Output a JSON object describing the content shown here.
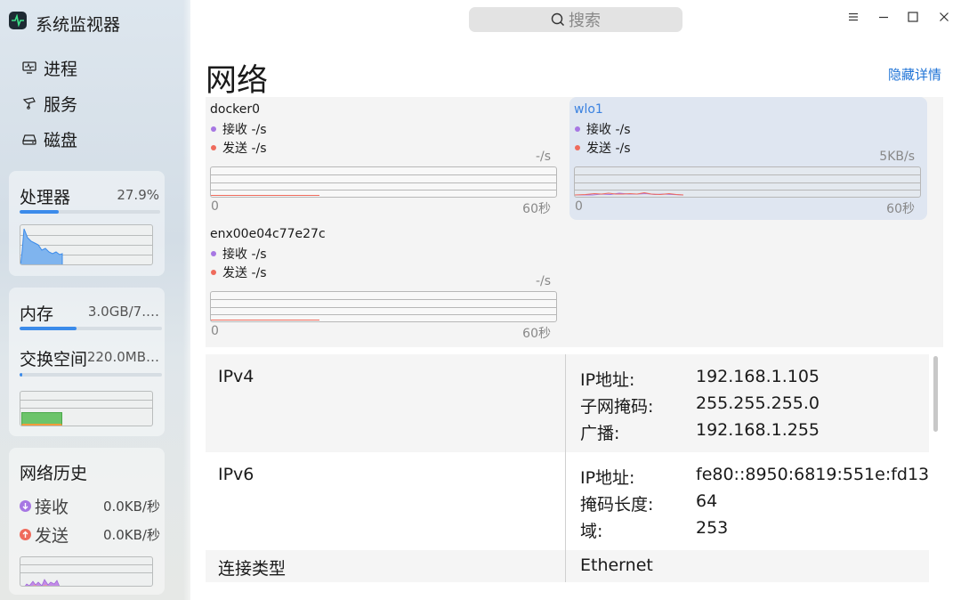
{
  "app": {
    "title": "系统监视器"
  },
  "nav": [
    {
      "label": "进程",
      "icon": "monitor-icon"
    },
    {
      "label": "服务",
      "icon": "service-icon"
    },
    {
      "label": "磁盘",
      "icon": "disk-icon"
    }
  ],
  "cpu": {
    "title": "处理器",
    "value": "27.9%",
    "percent": 0.279
  },
  "memory": {
    "title": "内存",
    "value": "3.0GB/7.…",
    "percent": 0.4
  },
  "swap": {
    "title": "交换空间",
    "value": "220.0MB…",
    "percent": 0.02
  },
  "net_history": {
    "title": "网络历史",
    "recv": {
      "label": "接收",
      "value": "0.0KB/秒"
    },
    "send": {
      "label": "发送",
      "value": "0.0KB/秒"
    }
  },
  "search": {
    "placeholder": "搜索"
  },
  "page": {
    "title": "网络",
    "toggle_label": "隐藏详情"
  },
  "interfaces": [
    {
      "name": "docker0",
      "recv": "接收 -/s",
      "send": "发送 -/s",
      "scale": "-/s",
      "axis_start": "0",
      "axis_end": "60秒",
      "selected": false
    },
    {
      "name": "wlo1",
      "recv": "接收 -/s",
      "send": "发送 -/s",
      "scale": "5KB/s",
      "axis_start": "0",
      "axis_end": "60秒",
      "selected": true
    },
    {
      "name": "enx00e04c77e27c",
      "recv": "接收 -/s",
      "send": "发送 -/s",
      "scale": "-/s",
      "axis_start": "0",
      "axis_end": "60秒",
      "selected": false
    }
  ],
  "details": {
    "ipv4": {
      "label": "IPv4",
      "fields": [
        {
          "k": "IP地址:",
          "v": "192.168.1.105"
        },
        {
          "k": "子网掩码:",
          "v": "255.255.255.0"
        },
        {
          "k": "广播:",
          "v": "192.168.1.255"
        }
      ]
    },
    "ipv6": {
      "label": "IPv6",
      "fields": [
        {
          "k": "IP地址:",
          "v": "fe80::8950:6819:551e:fd13"
        },
        {
          "k": "掩码长度:",
          "v": "64"
        },
        {
          "k": "域:",
          "v": "253"
        }
      ]
    },
    "conn": {
      "label": "连接类型",
      "v": "Ethernet"
    }
  },
  "colors": {
    "accent": "#3b8bea",
    "recv": "#a777e3",
    "send": "#ef6b5c",
    "link": "#1f73d6"
  }
}
